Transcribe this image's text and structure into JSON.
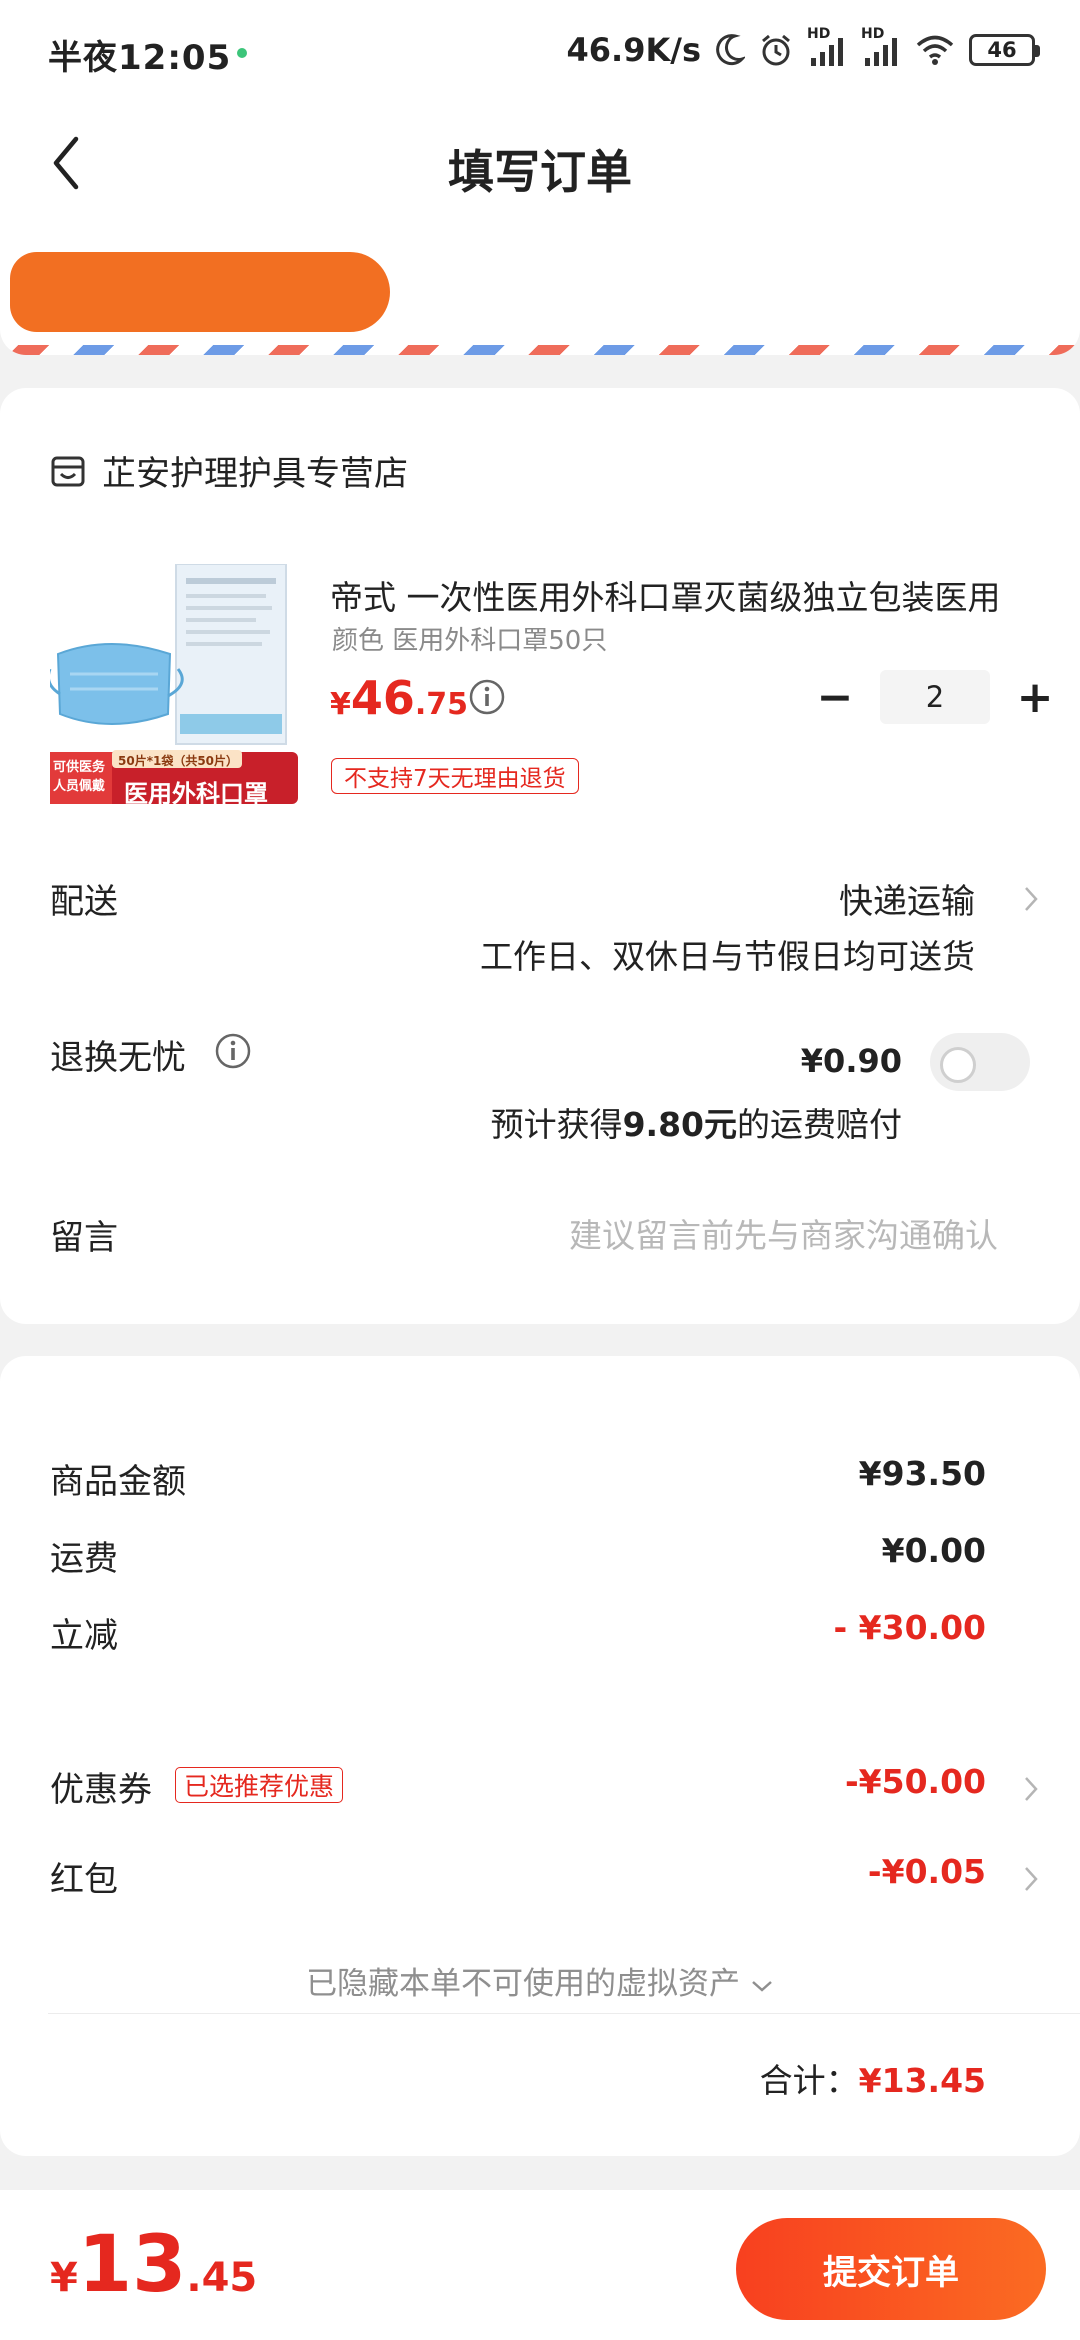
{
  "status_bar": {
    "time": "半夜12:05",
    "speed": "46.9K/s",
    "signal1": "HD",
    "signal2": "HD",
    "battery": "46"
  },
  "nav": {
    "title": "填写订单"
  },
  "store": {
    "name": "芷安护理护具专营店"
  },
  "product": {
    "title": "帝式 一次性医用外科口罩灭菌级独立包装医用",
    "spec": "颜色 医用外科口罩50只",
    "price_currency": "¥",
    "price_int": "46",
    "price_dec": ".75",
    "quantity": "2",
    "minus": "−",
    "plus": "+",
    "no_return_tag": "不支持7天无理由退货",
    "image_badge1": "可供医务人员佩戴",
    "image_badge2": "50片*1袋（共50片）",
    "image_badge3": "医用外科口罩"
  },
  "delivery": {
    "label": "配送",
    "method": "快递运输",
    "note": "工作日、双休日与节假日均可送货"
  },
  "exchange": {
    "label": "退换无忧",
    "price": "¥0.90",
    "note_prefix": "预计获得",
    "note_amount": "9.80元",
    "note_suffix": "的运费赔付"
  },
  "message": {
    "label": "留言",
    "placeholder": "建议留言前先与商家沟通确认"
  },
  "summary": {
    "goods_label": "商品金额",
    "goods_value": "¥93.50",
    "shipping_label": "运费",
    "shipping_value": "¥0.00",
    "discount_label": "立减",
    "discount_value": "- ¥30.00",
    "coupon_label": "优惠券",
    "coupon_tag": "已选推荐优惠",
    "coupon_value": "-¥50.00",
    "redpacket_label": "红包",
    "redpacket_value": "-¥0.05",
    "hidden_assets": "已隐藏本单不可使用的虚拟资产",
    "total_label": "合计：",
    "total_value": "¥13.45"
  },
  "bottom": {
    "price_currency": "¥",
    "price_int": "13",
    "price_dec": ".45",
    "submit_label": "提交订单"
  },
  "colors": {
    "accent_red": "#e5281f",
    "submit_gradient_start": "#f8401f",
    "submit_gradient_end": "#fb6b22",
    "address_redaction": "#f26f22"
  }
}
